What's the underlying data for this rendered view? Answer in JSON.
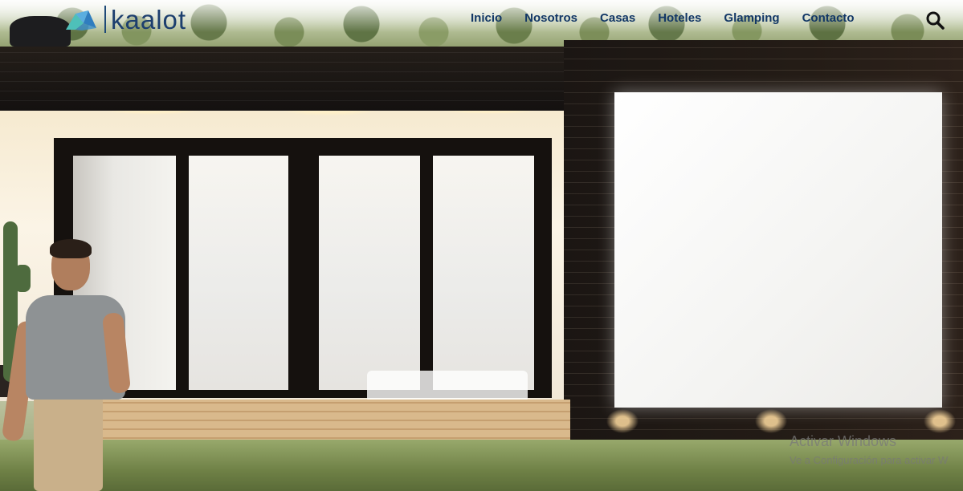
{
  "brand": {
    "name": "kaalot",
    "text_color": "#1d3f6e",
    "mark_colors": [
      "#4ec0b9",
      "#5aaee0",
      "#2f7dbf"
    ]
  },
  "nav": {
    "items": [
      {
        "label": "Inicio"
      },
      {
        "label": "Nosotros"
      },
      {
        "label": "Casas"
      },
      {
        "label": "Hoteles"
      },
      {
        "label": "Glamping"
      },
      {
        "label": "Contacto"
      }
    ],
    "text_color": "#123766",
    "search_icon": "search-icon"
  },
  "hero": {
    "image": "modern-container-house-with-man-walking"
  },
  "os_overlay": {
    "title": "Activar Windows",
    "subtitle": "Ve a Configuración para activar W"
  }
}
